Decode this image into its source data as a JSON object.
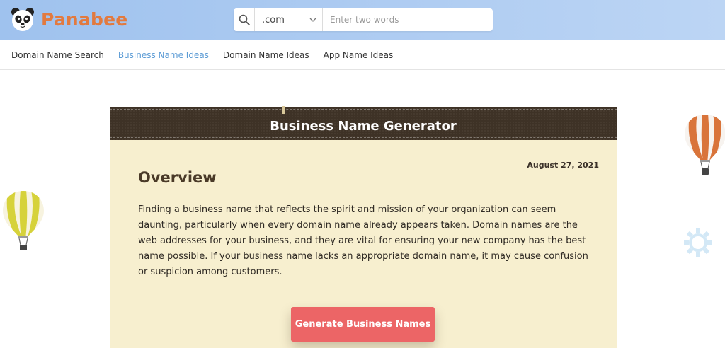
{
  "brand": {
    "name": "Panabee"
  },
  "search": {
    "tld": ".com",
    "placeholder": "Enter two words"
  },
  "nav": {
    "items": [
      {
        "label": "Domain Name Search"
      },
      {
        "label": "Business Name Ideas",
        "active": true
      },
      {
        "label": "Domain Name Ideas"
      },
      {
        "label": "App Name Ideas"
      }
    ]
  },
  "card": {
    "title": "Business Name Generator",
    "date": "August 27, 2021",
    "heading": "Overview",
    "paragraph": "Finding a business name that reflects the spirit and mission of your organization can seem daunting, particularly when every domain name already appears taken. Domain names are the web addresses for your business, and they are vital for ensuring your new company has the best name possible. If your business name lacks an appropriate domain name, it may cause confusion or suspicion among customers.",
    "cta_label": "Generate Business Names"
  },
  "colors": {
    "brand": "#e27a3f",
    "header_bg": "#a8c8f0",
    "card_head": "#3e3226",
    "card_bg": "#f7efcf",
    "cta": "#ec6566",
    "nav_active": "#5b9bd5"
  },
  "icons": [
    "panda-logo-icon",
    "search-icon",
    "chevron-down-icon",
    "yellow-balloon-icon",
    "orange-balloon-icon",
    "gear-icon"
  ]
}
